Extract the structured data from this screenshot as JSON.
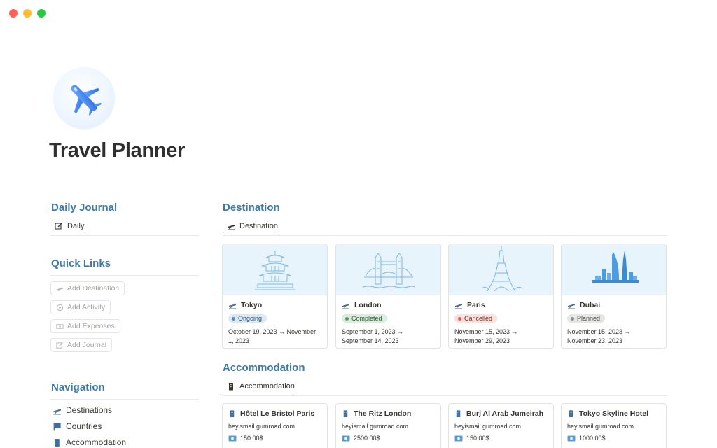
{
  "page": {
    "title": "Travel Planner"
  },
  "colors": {
    "accent": "#3f7ba6",
    "ongoing": "#5b8bc4",
    "completed": "#4f9a68",
    "cancelled": "#d65c5c",
    "planned": "#8c8c8c"
  },
  "daily_journal": {
    "title": "Daily Journal",
    "tab_label": "Daily"
  },
  "quick_links": {
    "title": "Quick Links",
    "items": [
      {
        "label": "Add Destination",
        "icon": "plane-icon"
      },
      {
        "label": "Add Activity",
        "icon": "compass-icon"
      },
      {
        "label": "Add Expenses",
        "icon": "money-icon"
      },
      {
        "label": "Add Journal",
        "icon": "pencil-icon"
      }
    ]
  },
  "navigation": {
    "title": "Navigation",
    "items": [
      {
        "label": "Destinations",
        "icon": "plane-icon"
      },
      {
        "label": "Countries",
        "icon": "flag-icon"
      },
      {
        "label": "Accommodation",
        "icon": "building-icon"
      }
    ]
  },
  "destination": {
    "title": "Destination",
    "tab_label": "Destination",
    "cards": [
      {
        "name": "Tokyo",
        "status": "Ongoing",
        "dates": "October 19, 2023 → November 1, 2023",
        "landmark": "pagoda"
      },
      {
        "name": "London",
        "status": "Completed",
        "dates": "September 1, 2023 → September 14, 2023",
        "landmark": "tower-bridge"
      },
      {
        "name": "Paris",
        "status": "Cancelled",
        "dates": "November 15, 2023 → November 29, 2023",
        "landmark": "eiffel-tower"
      },
      {
        "name": "Dubai",
        "status": "Planned",
        "dates": "November 15, 2023 → November 23, 2023",
        "landmark": "burj-al-arab"
      }
    ]
  },
  "accommodation": {
    "title": "Accommodation",
    "tab_label": "Accommodation",
    "cards": [
      {
        "name": "Hôtel Le Bristol Paris",
        "url": "heyismail.gumroad.com",
        "price": "150.00$"
      },
      {
        "name": "The Ritz London",
        "url": "heyismail.gumroad.com",
        "price": "2500.00$"
      },
      {
        "name": "Burj Al Arab Jumeirah",
        "url": "heyismail.gumroad.com",
        "price": "150.00$"
      },
      {
        "name": "Tokyo Skyline Hotel",
        "url": "heyismail.gumroad.com",
        "price": "1000.00$"
      }
    ]
  }
}
